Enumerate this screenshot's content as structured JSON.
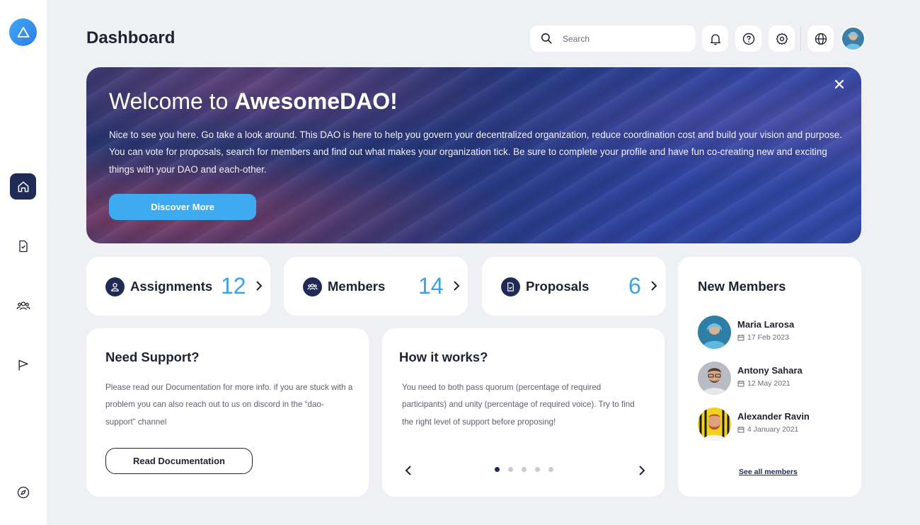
{
  "sidebar": {
    "logo_icon": "triangle-logo-icon",
    "items": [
      {
        "name": "home",
        "icon": "home-icon",
        "active": true
      },
      {
        "name": "proposals",
        "icon": "document-check-icon",
        "active": false
      },
      {
        "name": "members",
        "icon": "users-icon",
        "active": false
      },
      {
        "name": "flag",
        "icon": "flag-icon",
        "active": false
      },
      {
        "name": "explore",
        "icon": "compass-icon",
        "active": false
      }
    ]
  },
  "header": {
    "title": "Dashboard",
    "search_placeholder": "Search",
    "icons": [
      "bell-icon",
      "help-icon",
      "gear-icon",
      "globe-icon"
    ]
  },
  "hero": {
    "title_prefix": "Welcome to ",
    "title_brand": "AwesomeDAO!",
    "text": "Nice to see you here. Go take a look around. This DAO is here to help you govern your decentralized organization, reduce coordination cost and build your vision and purpose. You can vote for proposals, search for members and find out what makes your organization tick. Be sure to complete your profile and have fun co-creating new and exciting things with your DAO and each-other.",
    "button_label": "Discover More"
  },
  "stats": [
    {
      "label": "Assignments",
      "value": "12",
      "icon": "user-icon"
    },
    {
      "label": "Members",
      "value": "14",
      "icon": "users-icon"
    },
    {
      "label": "Proposals",
      "value": "6",
      "icon": "document-check-icon"
    }
  ],
  "support": {
    "title": "Need Support?",
    "text": "Please read our Documentation for more info. if you are stuck with a problem you can also reach out to us on discord in the “dao-support” channel",
    "button_label": "Read Documentation"
  },
  "how_it_works": {
    "title": "How it works?",
    "text": "You need to both pass quorum (percentage of required participants) and unity (percentage of required voice). Try to find the right level of support before proposing!",
    "slides_total": 5,
    "active_slide": 1
  },
  "new_members": {
    "title": "New Members",
    "members": [
      {
        "name": "Maria Larosa",
        "date": "17 Feb 2023"
      },
      {
        "name": "Antony Sahara",
        "date": "12 May 2021"
      },
      {
        "name": "Alexander Ravin",
        "date": "4 January 2021"
      }
    ],
    "see_all_label": "See all members"
  },
  "colors": {
    "navy": "#1f2a55",
    "accent_blue": "#3aa3e8",
    "button_blue": "#3eaaf0",
    "background": "#eef0f4"
  }
}
